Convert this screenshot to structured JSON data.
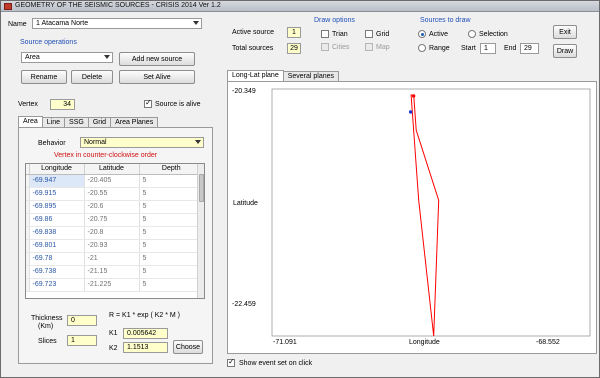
{
  "window": {
    "title": "GEOMETRY OF THE SEISMIC SOURCES - CRISIS 2014 Ver 1.2"
  },
  "name": {
    "label": "Name",
    "value": "1 Atacama Norte"
  },
  "source_operations": {
    "title": "Source operations",
    "type_value": "Area",
    "add_label": "Add new source",
    "rename_label": "Rename",
    "delete_label": "Delete",
    "set_alive_label": "Set Alive"
  },
  "vertex": {
    "label": "Vertex",
    "value": "34",
    "alive_label": "Source is alive"
  },
  "tabs": [
    {
      "label": "Area"
    },
    {
      "label": "Line"
    },
    {
      "label": "SSG"
    },
    {
      "label": "Grid"
    },
    {
      "label": "Area Planes"
    }
  ],
  "behavior": {
    "label": "Behavior",
    "value": "Normal"
  },
  "vertex_note": "Vertex in counter-clockwise order",
  "table": {
    "headers": [
      "Longitude",
      "Latitude",
      "Depth"
    ],
    "rows": [
      [
        "-69.947",
        "-20.405",
        "5"
      ],
      [
        "-69.915",
        "-20.55",
        "5"
      ],
      [
        "-69.895",
        "-20.6",
        "5"
      ],
      [
        "-69.86",
        "-20.75",
        "5"
      ],
      [
        "-69.838",
        "-20.8",
        "5"
      ],
      [
        "-69.801",
        "-20.93",
        "5"
      ],
      [
        "-69.78",
        "-21",
        "5"
      ],
      [
        "-69.738",
        "-21.15",
        "5"
      ],
      [
        "-69.723",
        "-21.225",
        "5"
      ]
    ]
  },
  "thickness": {
    "label1": "Thickness",
    "label2": "(Km)",
    "value": "0"
  },
  "slices": {
    "label": "Slices",
    "value": "1"
  },
  "formula": "R = K1 * exp ( K2 * M )",
  "k1": {
    "label": "K1",
    "value": "0.005642"
  },
  "k2": {
    "label": "K2",
    "value": "1.1513"
  },
  "choose_label": "Choose",
  "active_source": {
    "label": "Active source",
    "value": "1"
  },
  "total_sources": {
    "label": "Total sources",
    "value": "29"
  },
  "draw_options": {
    "title": "Draw options",
    "trian": "Trian",
    "grid": "Grid",
    "cities": "Cities",
    "map": "Map"
  },
  "sources_to_draw": {
    "title": "Sources to draw",
    "active": "Active",
    "selection": "Selection",
    "range": "Range",
    "start_label": "Start",
    "start_value": "1",
    "end_label": "End",
    "end_value": "29"
  },
  "exit_label": "Exit",
  "draw_label": "Draw",
  "plot_tabs": [
    {
      "label": "Long-Lat plane"
    },
    {
      "label": "Several planes"
    }
  ],
  "plot": {
    "ylabel": "Latitude",
    "xlabel": "Longitude",
    "y_top": "-20.349",
    "y_bottom": "-22.459",
    "x_left": "-71.091",
    "x_right": "-68.552",
    "line_color": "#ff0000",
    "point_color": "#2233cc"
  },
  "show_event_label": "Show event set on click",
  "chart_data": {
    "type": "line",
    "xlabel": "Longitude",
    "ylabel": "Latitude",
    "xlim": [
      -71.091,
      -68.552
    ],
    "ylim": [
      -22.459,
      -20.349
    ],
    "series": [
      {
        "x": [
          -69.98,
          -69.96,
          -69.94,
          -69.76,
          -69.8,
          -69.92,
          -69.98
        ],
        "y": [
          -20.4,
          -20.4,
          -20.7,
          -21.3,
          -22.459,
          -21.3,
          -20.4
        ]
      }
    ]
  }
}
